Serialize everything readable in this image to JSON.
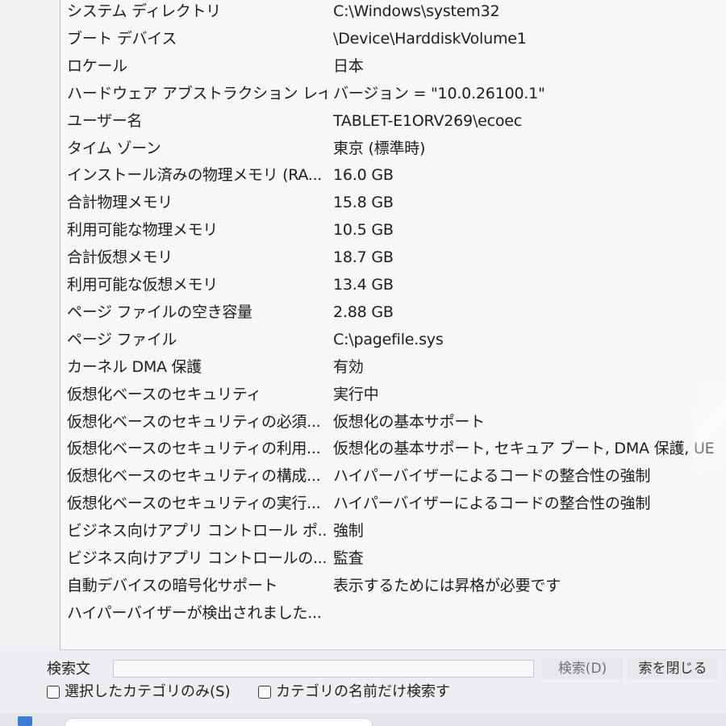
{
  "rows": [
    {
      "name": "システム ディレクトリ",
      "value": "C:\\Windows\\system32"
    },
    {
      "name": "ブート デバイス",
      "value": "\\Device\\HarddiskVolume1"
    },
    {
      "name": "ロケール",
      "value": "日本"
    },
    {
      "name": "ハードウェア アブストラクション レイ...",
      "value": "バージョン = \"10.0.26100.1\""
    },
    {
      "name": "ユーザー名",
      "value": "TABLET-E1ORV269\\ecoec"
    },
    {
      "name": "タイム ゾーン",
      "value": "東京 (標準時)"
    },
    {
      "name": "インストール済みの物理メモリ (RA...",
      "value": "16.0 GB"
    },
    {
      "name": "合計物理メモリ",
      "value": "15.8 GB"
    },
    {
      "name": "利用可能な物理メモリ",
      "value": "10.5 GB"
    },
    {
      "name": "合計仮想メモリ",
      "value": "18.7 GB"
    },
    {
      "name": "利用可能な仮想メモリ",
      "value": "13.4 GB"
    },
    {
      "name": "ページ ファイルの空き容量",
      "value": "2.88 GB"
    },
    {
      "name": "ページ ファイル",
      "value": "C:\\pagefile.sys"
    },
    {
      "name": "カーネル DMA 保護",
      "value": "有効"
    },
    {
      "name": "仮想化ベースのセキュリティ",
      "value": "実行中"
    },
    {
      "name": "仮想化ベースのセキュリティの必須...",
      "value": "仮想化の基本サポート"
    },
    {
      "name": "仮想化ベースのセキュリティの利用...",
      "value": "仮想化の基本サポート, セキュア ブート, DMA 保護, UE"
    },
    {
      "name": "仮想化ベースのセキュリティの構成...",
      "value": "ハイパーバイザーによるコードの整合性の強制"
    },
    {
      "name": "仮想化ベースのセキュリティの実行...",
      "value": "ハイパーバイザーによるコードの整合性の強制"
    },
    {
      "name": "ビジネス向けアプリ コントロール ポ...",
      "value": "強制"
    },
    {
      "name": "ビジネス向けアプリ コントロールの...",
      "value": "監査"
    },
    {
      "name": "自動デバイスの暗号化サポート",
      "value": "表示するためには昇格が必要です"
    },
    {
      "name": "ハイパーバイザーが検出されました...",
      "value": ""
    }
  ],
  "search": {
    "label": "検索文",
    "value": "",
    "search_button": "検索(D)",
    "close_button": "索を閉じる"
  },
  "options": {
    "selected_category_only": "選択したカテゴリのみ(S)",
    "category_names_only": "カテゴリの名前だけ検索す"
  }
}
